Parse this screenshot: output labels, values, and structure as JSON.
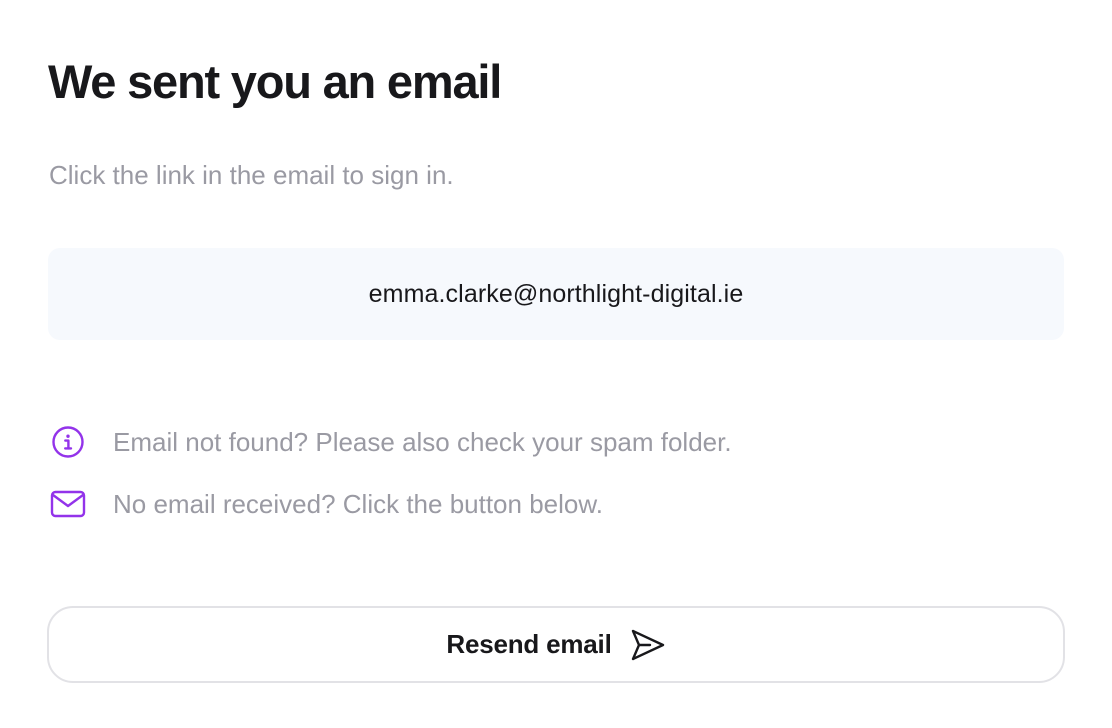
{
  "header": {
    "title": "We sent you an email",
    "subtitle": "Click the link in the email to sign in."
  },
  "email": {
    "address": "emma.clarke@northlight-digital.ie"
  },
  "hints": [
    {
      "icon": "info-icon",
      "text": "Email not found? Please also check your spam folder."
    },
    {
      "icon": "mail-icon",
      "text": "No email received? Click the button below."
    }
  ],
  "actions": {
    "resend_label": "Resend email",
    "resend_icon": "send-icon"
  },
  "colors": {
    "accent": "#9333ea",
    "muted_text": "#9a9aa3",
    "email_box_bg": "#f6f9fd"
  }
}
